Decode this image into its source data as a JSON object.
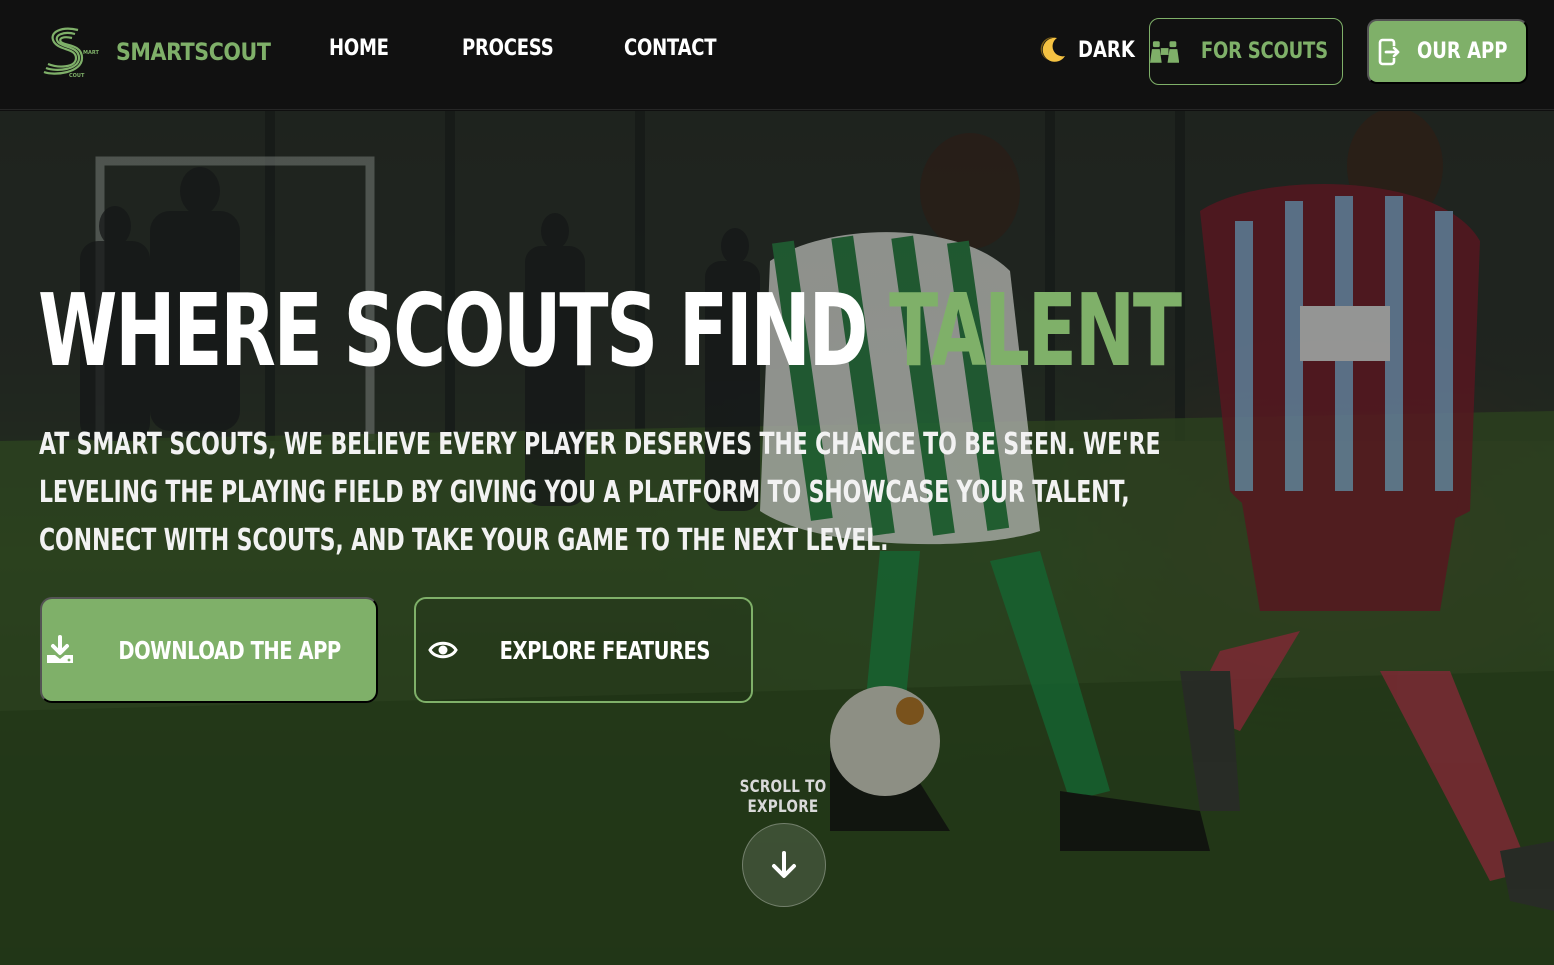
{
  "brand": {
    "name": "SMARTSCOUT",
    "logo_text_top": "MART",
    "logo_text_bottom": "COUT"
  },
  "nav": {
    "links": [
      {
        "label": "HOME"
      },
      {
        "label": "PROCESS"
      },
      {
        "label": "CONTACT"
      }
    ],
    "theme_toggle": {
      "label": "DARK",
      "icon": "moon-icon"
    },
    "scouts_button": {
      "label": "FOR SCOUTS",
      "icon": "binoculars-icon"
    },
    "app_button": {
      "label": "OUR APP",
      "icon": "app-enter-icon"
    }
  },
  "hero": {
    "title_main": "WHERE SCOUTS FIND",
    "title_accent": "TALENT",
    "paragraph": "AT SMART SCOUTS, WE BELIEVE EVERY PLAYER DESERVES THE CHANCE TO BE SEEN. WE'RE LEVELING THE PLAYING FIELD BY GIVING YOU A PLATFORM TO SHOWCASE YOUR TALENT, CONNECT WITH SCOUTS, AND TAKE YOUR GAME TO THE NEXT LEVEL.",
    "download_button": {
      "label": "DOWNLOAD THE APP",
      "icon": "download-icon"
    },
    "explore_button": {
      "label": "EXPLORE FEATURES",
      "icon": "eye-icon"
    },
    "scroll_label": "SCROLL TO EXPLORE",
    "scroll_icon": "arrow-down-icon"
  },
  "colors": {
    "accent": "#7fb069",
    "nav_bg": "#111111",
    "text": "#ffffff"
  }
}
